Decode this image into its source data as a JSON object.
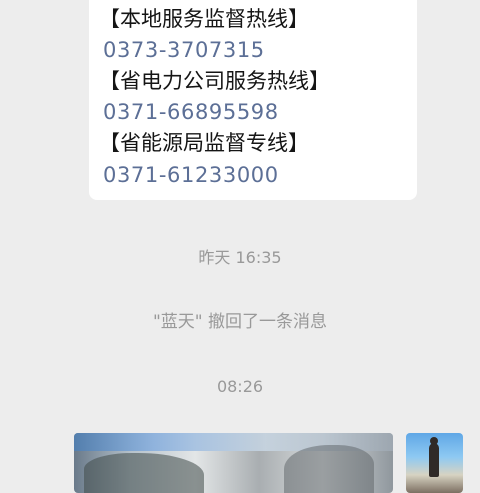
{
  "contact_message": {
    "lines": [
      "【本地服务监督热线】",
      "0373-3707315",
      "【省电力公司服务热线】",
      "0371-66895598",
      "【省能源局监督专线】",
      "0371-61233000"
    ]
  },
  "system_messages": {
    "timestamp_1": "昨天 16:35",
    "recall_notice": "\"蓝天\" 撤回了一条消息",
    "timestamp_2": "08:26"
  },
  "colors": {
    "background": "#ededed",
    "bubble": "#ffffff",
    "phone_number": "#5c6f96",
    "system_text": "#999999"
  }
}
